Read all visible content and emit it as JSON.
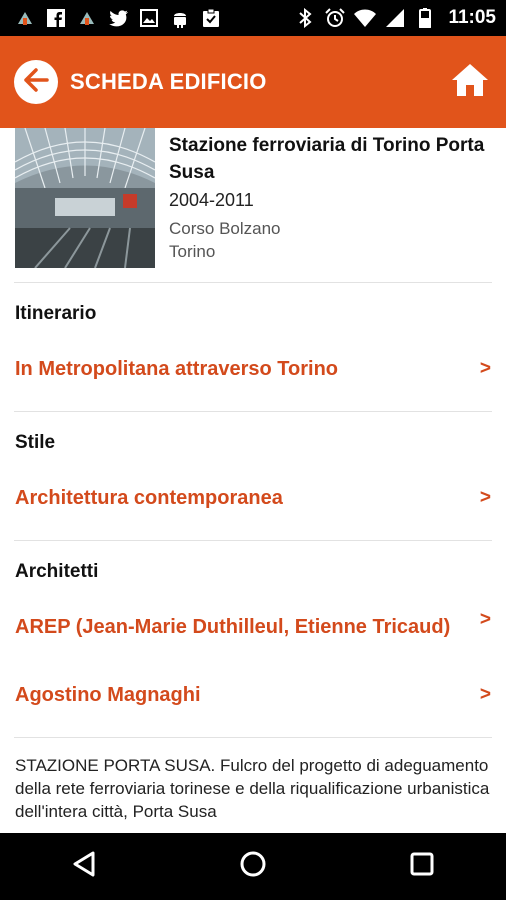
{
  "status_bar": {
    "time": "11:05",
    "left_icons": [
      "notification-icon",
      "facebook-icon",
      "notification-icon",
      "twitter-icon",
      "image-icon",
      "android-icon",
      "clipboard-icon"
    ],
    "right_icons": [
      "bluetooth-icon",
      "alarm-icon",
      "wifi-icon",
      "signal-icon",
      "battery-icon"
    ]
  },
  "app_bar": {
    "title": "SCHEDA EDIFICIO",
    "back_icon": "back-arrow-icon",
    "home_icon": "home-icon",
    "accent": "#e1541b"
  },
  "building": {
    "name": "Stazione ferroviaria di Torino Porta Susa",
    "years": "2004-2011",
    "address_line1": "Corso Bolzano",
    "address_line2": "Torino"
  },
  "sections": {
    "itinerario": {
      "title": "Itinerario",
      "items": [
        {
          "label": "In Metropolitana attraverso Torino",
          "chevron": ">"
        }
      ]
    },
    "stile": {
      "title": "Stile",
      "items": [
        {
          "label": "Architettura contemporanea",
          "chevron": ">"
        }
      ]
    },
    "architetti": {
      "title": "Architetti",
      "items": [
        {
          "label": "AREP (Jean-Marie Duthilleul, Etienne Tricaud)",
          "chevron": ">"
        },
        {
          "label": "Agostino Magnaghi",
          "chevron": ">"
        }
      ]
    }
  },
  "description": "STAZIONE PORTA SUSA. Fulcro del progetto di adeguamento della rete ferroviaria torinese e della riqualificazione urbanistica dell'intera città, Porta Susa",
  "link_color": "#d34a1c",
  "nav_bar": {
    "back_icon": "nav-back-icon",
    "home_icon": "nav-home-icon",
    "recents_icon": "nav-recents-icon"
  }
}
